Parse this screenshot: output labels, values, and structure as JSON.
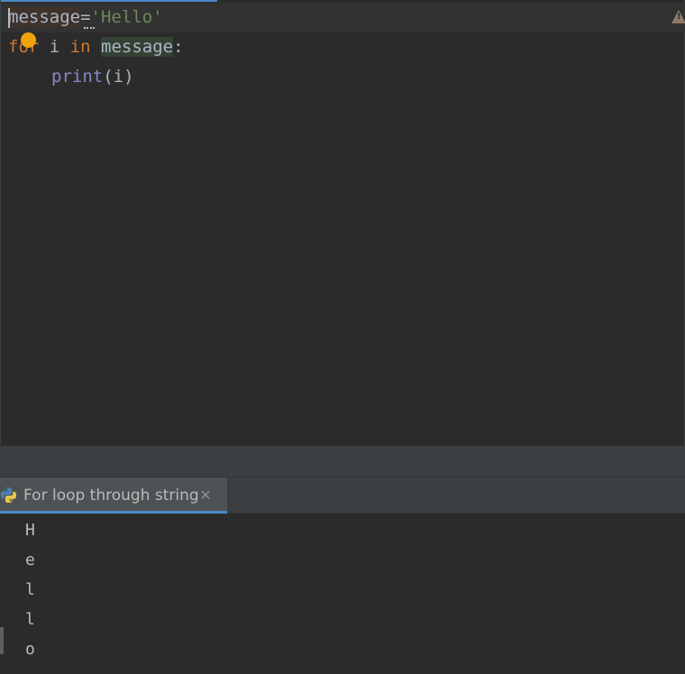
{
  "editor": {
    "line1": {
      "ident": "message",
      "op": "=",
      "string": "'Hello'"
    },
    "line2": {
      "kw_for": "for",
      "space1": " ",
      "var": "i",
      "space2": " ",
      "kw_in": "in",
      "space3": " ",
      "ident": "message",
      "colon": ":"
    },
    "line3": {
      "builtin": "print",
      "args": "(i)"
    }
  },
  "run_panel": {
    "tab_label": "For loop through string",
    "close_glyph": "✕"
  },
  "console": {
    "lines": [
      "H",
      "e",
      "l",
      "l",
      "o"
    ]
  },
  "colors": {
    "keyword": "#cc7832",
    "string": "#6a8759",
    "builtin": "#8888c6",
    "text": "#a9b7c6",
    "accent": "#4a88c7",
    "bulb": "#f0a30a"
  },
  "icons": {
    "bulb": "intention-bulb-icon",
    "warning": "warning-icon",
    "tab": "python-icon",
    "close": "close-icon"
  }
}
